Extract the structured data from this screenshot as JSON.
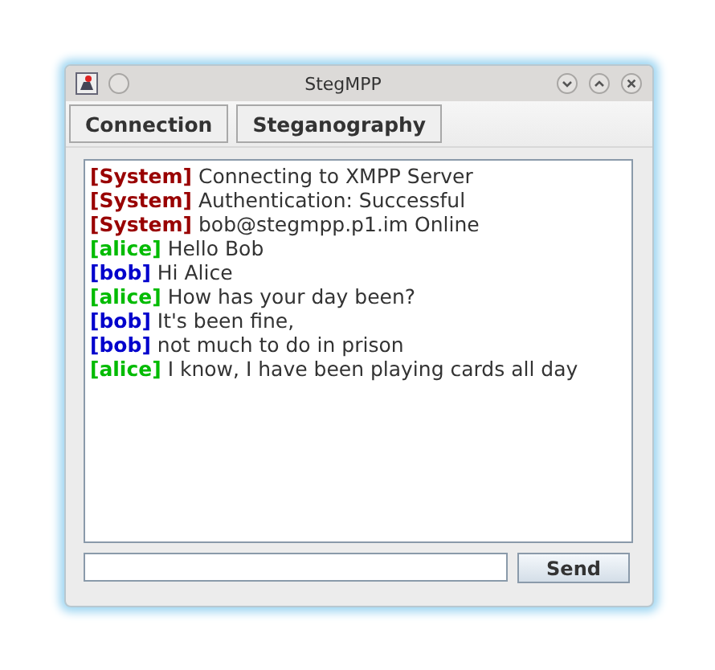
{
  "window": {
    "title": "StegMPP"
  },
  "menu": [
    "Connection",
    "Steganography"
  ],
  "messages": [
    {
      "sender": "[System]",
      "color": "#990000",
      "text": "Connecting to XMPP Server"
    },
    {
      "sender": "[System]",
      "color": "#990000",
      "text": "Authentication: Successful"
    },
    {
      "sender": "[System]",
      "color": "#990000",
      "text": "bob@stegmpp.p1.im Online"
    },
    {
      "sender": "[alice]",
      "color": "#00bb00",
      "text": "Hello Bob"
    },
    {
      "sender": "[bob]",
      "color": "#0000cc",
      "text": "Hi Alice"
    },
    {
      "sender": "[alice]",
      "color": "#00bb00",
      "text": "How has your day been?"
    },
    {
      "sender": "[bob]",
      "color": "#0000cc",
      "text": "It's been fine,"
    },
    {
      "sender": "[bob]",
      "color": "#0000cc",
      "text": "not much to do in prison"
    },
    {
      "sender": "[alice]",
      "color": "#00bb00",
      "text": "I know, I have been playing cards all day"
    }
  ],
  "send_button": "Send"
}
